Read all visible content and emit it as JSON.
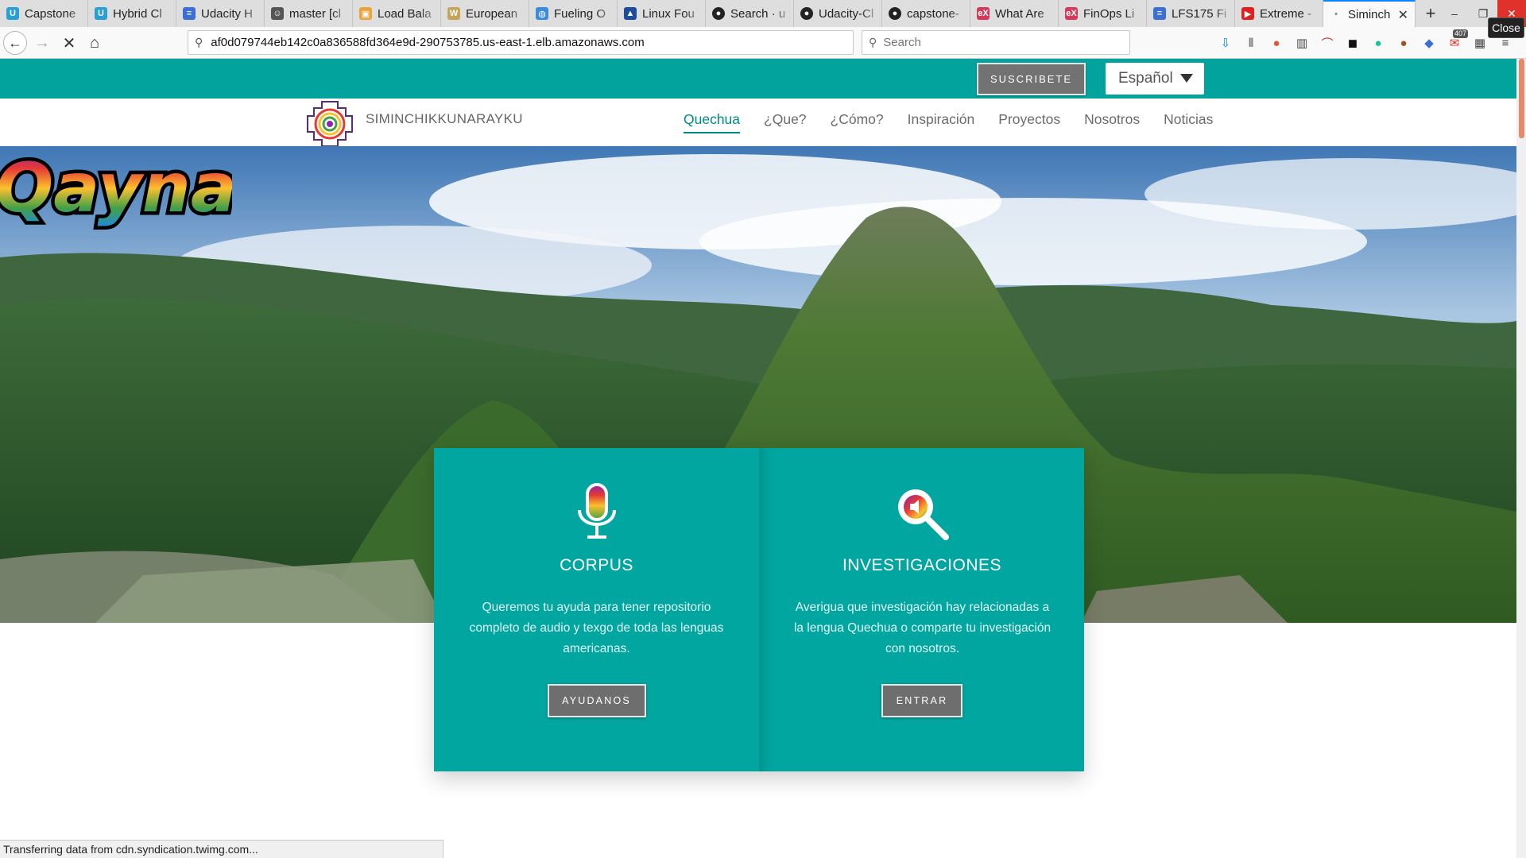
{
  "tabs": [
    {
      "label": "Capstone",
      "icon": "udacity-icon",
      "color": "#2a9fd6"
    },
    {
      "label": "Hybrid Cl",
      "icon": "udacity-icon",
      "color": "#2a9fd6"
    },
    {
      "label": "Udacity H",
      "icon": "doc-icon",
      "color": "#3b6fd4"
    },
    {
      "label": "master [cl",
      "icon": "octocat-icon",
      "color": "#555555"
    },
    {
      "label": "Load Bala",
      "icon": "aws-icon",
      "color": "#e8a33b"
    },
    {
      "label": "European",
      "icon": "wiki-icon",
      "color": "#c8a45a"
    },
    {
      "label": "Fueling O",
      "icon": "globe-icon",
      "color": "#3b8bdb"
    },
    {
      "label": "Linux Fou",
      "icon": "linux-foundation-icon",
      "color": "#1c4c9e"
    },
    {
      "label": "Search · u",
      "icon": "github-icon",
      "color": "#222222"
    },
    {
      "label": "Udacity-Cl",
      "icon": "github-icon",
      "color": "#222222"
    },
    {
      "label": "capstone-",
      "icon": "github-icon",
      "color": "#222222"
    },
    {
      "label": "What Are",
      "icon": "edx-icon",
      "color": "#d63a5a"
    },
    {
      "label": "FinOps Li",
      "icon": "edx-icon",
      "color": "#d63a5a"
    },
    {
      "label": "LFS175 Fi",
      "icon": "doc-icon",
      "color": "#3b6fd4"
    },
    {
      "label": "Extreme -",
      "icon": "youtube-icon",
      "color": "#e02020"
    },
    {
      "label": "Siminch",
      "icon": "loading-icon",
      "color": "#888888",
      "active": true
    }
  ],
  "window": {
    "close_tooltip": "Close"
  },
  "navbar": {
    "url": "af0d079744eb142c0a836588fd364e9d-290753785.us-east-1.elb.amazonaws.com",
    "search_placeholder": "Search",
    "mail_count": "407"
  },
  "site": {
    "subscribe_label": "SUSCRIBETE",
    "language": "Español",
    "brand": "SIMINCHIKKUNARAYKU",
    "menu": [
      {
        "label": "Quechua",
        "current": true
      },
      {
        "label": "¿Que?"
      },
      {
        "label": "¿Cómo?"
      },
      {
        "label": "Inspiración"
      },
      {
        "label": "Proyectos"
      },
      {
        "label": "Nosotros"
      },
      {
        "label": "Noticias"
      }
    ],
    "hero_logo_text": "Qayna",
    "cards": [
      {
        "icon": "microphone-icon",
        "title": "CORPUS",
        "text": "Queremos tu ayuda para tener repositorio completo de audio y texgo de toda las lenguas americanas.",
        "button": "AYUDANOS"
      },
      {
        "icon": "search-audio-icon",
        "title": "INVESTIGACIONES",
        "text": "Averigua que investigación hay relacionadas a la lengua Quechua o comparte tu investigación con nosotros.",
        "button": "ENTRAR"
      }
    ]
  },
  "status_text": "Transferring data from cdn.syndication.twimg.com...",
  "colors": {
    "teal": "#02a39c",
    "card": "#00a69f",
    "button_gray": "#6e6e6e",
    "accent_blue": "#0a84ff"
  }
}
